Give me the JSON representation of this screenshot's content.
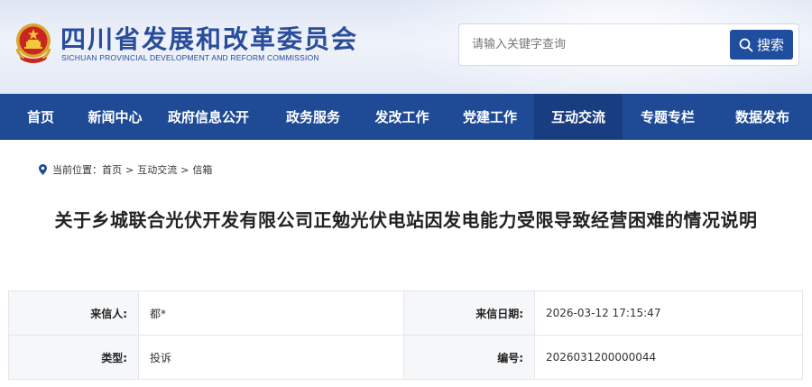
{
  "header": {
    "title": "四川省发展和改革委员会",
    "subtitle": "SICHUAN PROVINCIAL DEVELOPMENT AND REFORM COMMISSION",
    "emblem_icon": "national-emblem-icon"
  },
  "search": {
    "placeholder": "请输入关键字查询",
    "button_label": "搜索",
    "icon": "search-icon"
  },
  "nav": {
    "items": [
      {
        "label": "首页"
      },
      {
        "label": "新闻中心"
      },
      {
        "label": "政府信息公开"
      },
      {
        "label": "政务服务"
      },
      {
        "label": "发改工作"
      },
      {
        "label": "党建工作"
      },
      {
        "label": "互动交流"
      },
      {
        "label": "专题专栏"
      },
      {
        "label": "数据发布"
      }
    ],
    "active": "互动交流"
  },
  "breadcrumb": {
    "prefix": "当前位置：",
    "items": [
      "首页",
      "互动交流",
      "信箱"
    ],
    "separator": ">"
  },
  "article": {
    "title": "关于乡城联合光伏开发有限公司正勉光伏电站因发电能力受限导致经营困难的情况说明"
  },
  "info": {
    "rows": [
      {
        "label1": "来信人:",
        "value1": "都*",
        "label2": "来信日期:",
        "value2": "2026-03-12 17:15:47"
      },
      {
        "label1": "类型:",
        "value1": "投诉",
        "label2": "编号:",
        "value2": "2026031200000044"
      }
    ]
  },
  "colors": {
    "nav_bg": "#1e4a96",
    "nav_active_bg": "#183d80",
    "brand_text": "#2a4c9b",
    "search_button": "#1f4e9e"
  }
}
